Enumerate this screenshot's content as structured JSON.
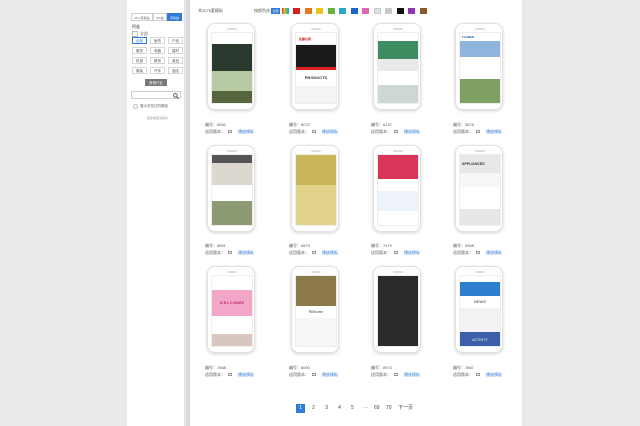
{
  "sidebar": {
    "segments": [
      {
        "label": "PC+手机站",
        "active": false
      },
      {
        "label": "PC站",
        "active": false
      },
      {
        "label": "手机站",
        "active": true
      }
    ],
    "filter_label": "行业",
    "tags": [
      {
        "label": "全部",
        "active": true
      },
      {
        "label": "医药",
        "active": false
      },
      {
        "label": "产品",
        "active": false
      },
      {
        "label": "服务",
        "active": false
      },
      {
        "label": "电器",
        "active": false
      },
      {
        "label": "建材",
        "active": false
      },
      {
        "label": "机械",
        "active": false
      },
      {
        "label": "教育",
        "active": false
      },
      {
        "label": "食品",
        "active": false
      },
      {
        "label": "服装",
        "active": false
      },
      {
        "label": "汽车",
        "active": false
      },
      {
        "label": "酒店",
        "active": false
      }
    ],
    "more_button": "其他行业",
    "search_placeholder": "",
    "option_label": "展示浏览过的模板",
    "footer_note": "更多模板请联系"
  },
  "toolbar": {
    "count_label": "共3276套模板",
    "color_label": "按颜色选：",
    "all_colors_label": "全部"
  },
  "colors": [
    "#d62020",
    "#e5751f",
    "#f1c21b",
    "#69b33f",
    "#2aa5c9",
    "#1b66c8",
    "#e163b4",
    "#e1e1e1",
    "#c8c8c8",
    "#111111",
    "#8a36b5",
    "#8a5a2a"
  ],
  "templates": [
    {
      "id": "编号：5540",
      "ver": "适用版本：",
      "link": "播放模板"
    },
    {
      "id": "编号：8072",
      "ver": "适用版本：",
      "link": "播放模板",
      "brand": "佐藤仪表",
      "slogan": "PRODUCTS"
    },
    {
      "id": "编号：6137",
      "ver": "适用版本：",
      "link": "播放模板"
    },
    {
      "id": "编号：5876",
      "ver": "适用版本：",
      "link": "播放模板",
      "brand": "FLOBEN"
    },
    {
      "id": "编号：8891",
      "ver": "适用版本：",
      "link": "播放模板"
    },
    {
      "id": "编号：6875",
      "ver": "适用版本：",
      "link": "播放模板"
    },
    {
      "id": "编号：7470",
      "ver": "适用版本：",
      "link": "播放模板"
    },
    {
      "id": "编号：9358",
      "ver": "适用版本：",
      "link": "播放模板",
      "slogan": "APPLIANCES"
    },
    {
      "id": "编号：7568",
      "ver": "适用版本：",
      "link": "播放模板",
      "slogan": "D·E L C ONGS"
    },
    {
      "id": "编号：8000",
      "ver": "适用版本：",
      "link": "播放模板",
      "slogan": "Welcome"
    },
    {
      "id": "编号：8973",
      "ver": "适用版本：",
      "link": "播放模板"
    },
    {
      "id": "编号：7867",
      "ver": "适用版本：",
      "link": "播放模板",
      "slogan": "NEWS",
      "slogan2": "ACTIVITY"
    }
  ],
  "pagination": {
    "pages": [
      "1",
      "2",
      "3",
      "4",
      "5",
      "···",
      "69",
      "70"
    ],
    "next": "下一页",
    "current": "1"
  }
}
